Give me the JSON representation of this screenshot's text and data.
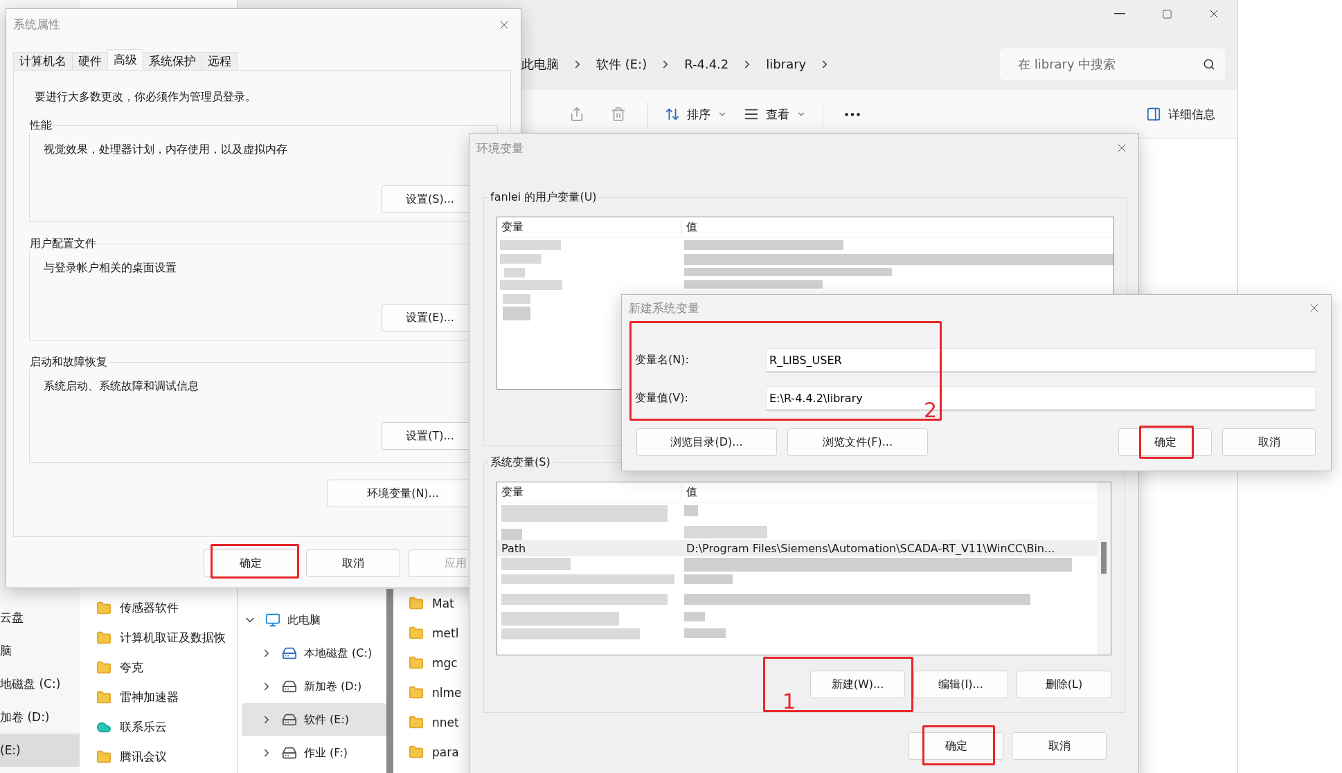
{
  "back_window": {
    "nav_items": [
      {
        "label": "云盘",
        "selected": false
      },
      {
        "label": "脑",
        "selected": false
      },
      {
        "label": "地磁盘 (C:)",
        "selected": false
      },
      {
        "label": "加卷 (D:)",
        "selected": false
      },
      {
        "label": "(E:)",
        "selected": true
      }
    ],
    "folders": [
      {
        "name": "传感器软件",
        "kind": "folder"
      },
      {
        "name": "计算机取证及数据恢",
        "kind": "folder"
      },
      {
        "name": "夸克",
        "kind": "folder"
      },
      {
        "name": "雷神加速器",
        "kind": "folder"
      },
      {
        "name": "联系乐云",
        "kind": "cloud"
      },
      {
        "name": "腾讯会议",
        "kind": "folder"
      }
    ]
  },
  "explorer": {
    "breadcrumbs": [
      "此电脑",
      "软件 (E:)",
      "R-4.4.2",
      "library"
    ],
    "search": {
      "placeholder": "在 library 中搜索"
    },
    "toolbar": {
      "sort": "排序",
      "view": "查看",
      "details": "详细信息"
    },
    "nav_tree": [
      {
        "label": "此电脑",
        "kind": "pc",
        "expanded": true,
        "selected": false
      },
      {
        "label": "本地磁盘 (C:)",
        "kind": "system_drive",
        "expanded": false,
        "selected": false
      },
      {
        "label": "新加卷 (D:)",
        "kind": "drive",
        "expanded": false,
        "selected": false
      },
      {
        "label": "软件 (E:)",
        "kind": "drive",
        "expanded": false,
        "selected": true
      },
      {
        "label": "作业 (F:)",
        "kind": "drive",
        "expanded": false,
        "selected": false
      }
    ],
    "files": [
      "Mat",
      "metl",
      "mgc",
      "nlme",
      "nnet",
      "para"
    ]
  },
  "system_properties": {
    "title": "系统属性",
    "tabs": [
      {
        "label": "计算机名",
        "selected": false
      },
      {
        "label": "硬件",
        "selected": false
      },
      {
        "label": "高级",
        "selected": true
      },
      {
        "label": "系统保护",
        "selected": false
      },
      {
        "label": "远程",
        "selected": false
      }
    ],
    "notice": "要进行大多数更改，你必须作为管理员登录。",
    "groups": [
      {
        "title": "性能",
        "description": "视觉效果，处理器计划，内存使用，以及虚拟内存",
        "button": "设置(S)..."
      },
      {
        "title": "用户配置文件",
        "description": "与登录帐户相关的桌面设置",
        "button": "设置(E)..."
      },
      {
        "title": "启动和故障恢复",
        "description": "系统启动、系统故障和调试信息",
        "button": "设置(T)..."
      }
    ],
    "env_button": "环境变量(N)...",
    "buttons": [
      {
        "label": "确定",
        "disabled": false,
        "highlighted": true
      },
      {
        "label": "取消",
        "disabled": false,
        "highlighted": false
      },
      {
        "label": "应用",
        "disabled": true,
        "highlighted": false
      }
    ]
  },
  "env_dialog": {
    "title": "环境变量",
    "user_group": {
      "title": "fanlei 的用户变量(U)",
      "columns": [
        "变量",
        "值"
      ]
    },
    "system_group": {
      "title": "系统变量(S)",
      "columns": [
        "变量",
        "值"
      ],
      "rows": [
        {
          "name": "Path",
          "value": "D:\\Program Files\\Siemens\\Automation\\SCADA-RT_V11\\WinCC\\Bin...",
          "selected": true
        }
      ],
      "buttons": [
        {
          "label": "新建(W)...",
          "highlighted": true,
          "callout": "1"
        },
        {
          "label": "编辑(I)...",
          "highlighted": false
        },
        {
          "label": "删除(L)",
          "highlighted": false
        }
      ]
    },
    "buttons": [
      {
        "label": "确定",
        "highlighted": true
      },
      {
        "label": "取消",
        "highlighted": false
      }
    ]
  },
  "new_var_dialog": {
    "title": "新建系统变量",
    "fields": [
      {
        "label": "变量名(N):",
        "value": "R_LIBS_USER"
      },
      {
        "label": "变量值(V):",
        "value": "E:\\R-4.4.2\\library"
      }
    ],
    "fields_highlighted": true,
    "fields_callout": "2",
    "browse_buttons": [
      "浏览目录(D)...",
      "浏览文件(F)..."
    ],
    "buttons": [
      {
        "label": "确定",
        "highlighted": true
      },
      {
        "label": "取消",
        "highlighted": false
      }
    ]
  }
}
